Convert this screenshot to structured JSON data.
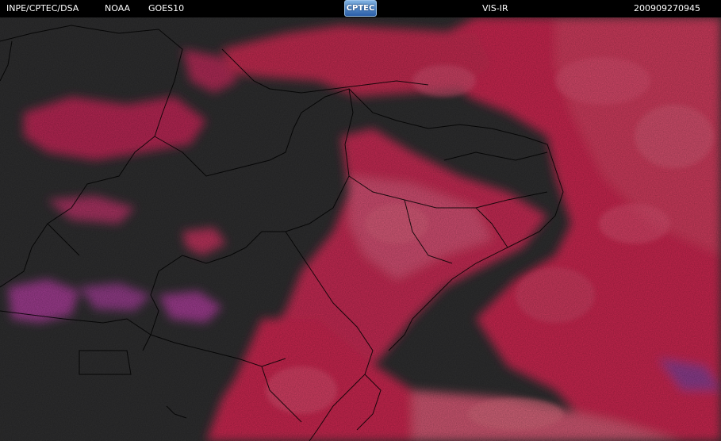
{
  "header": {
    "agency": "INPE/CPTEC/DSA",
    "source": "NOAA",
    "satellite": "GOES10",
    "logo_text": "CPTEC",
    "channel": "VIS-IR",
    "timestamp": "200909270945"
  },
  "colors": {
    "background": "#2e2e2f",
    "cloud": "#c8284f",
    "cloud_light": "#d8506f",
    "cloud_violet": "#9b3a8c",
    "border_lines": "#000000"
  }
}
